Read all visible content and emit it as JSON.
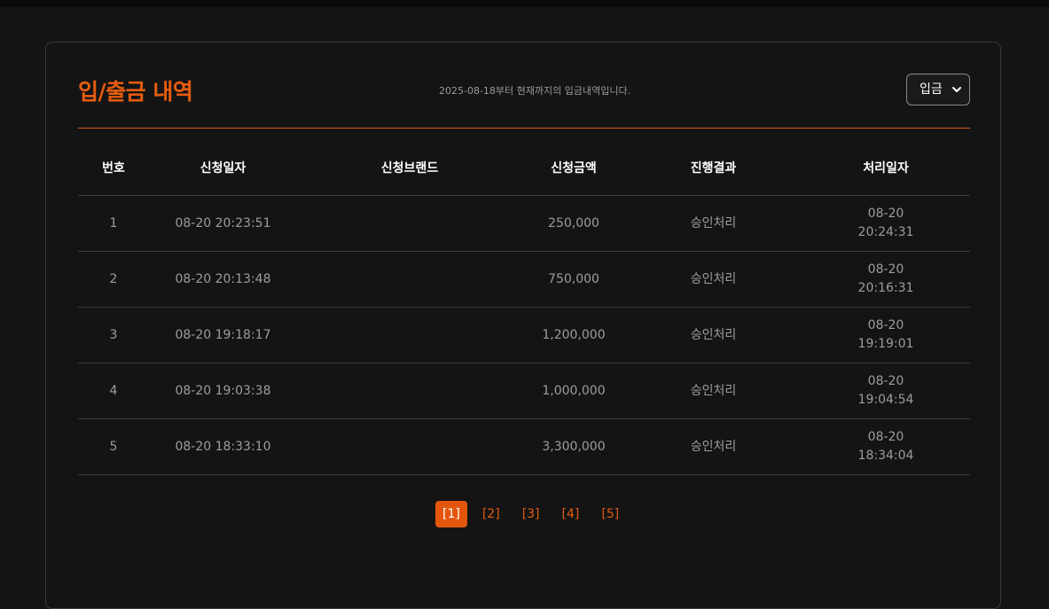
{
  "header": {
    "title": "입/출금 내역",
    "subtitle": "2025-08-18부터 현재까지의 입금내역입니다.",
    "type_select": {
      "selected": "입금"
    }
  },
  "table": {
    "columns": [
      "번호",
      "신청일자",
      "신청브랜드",
      "신청금액",
      "진행결과",
      "처리일자"
    ],
    "rows": [
      {
        "no": "1",
        "request_date": "08-20 20:23:51",
        "brand": "",
        "amount": "250,000",
        "result": "승인처리",
        "processed_date": "08-20",
        "processed_time": "20:24:31"
      },
      {
        "no": "2",
        "request_date": "08-20 20:13:48",
        "brand": "",
        "amount": "750,000",
        "result": "승인처리",
        "processed_date": "08-20",
        "processed_time": "20:16:31"
      },
      {
        "no": "3",
        "request_date": "08-20 19:18:17",
        "brand": "",
        "amount": "1,200,000",
        "result": "승인처리",
        "processed_date": "08-20",
        "processed_time": "19:19:01"
      },
      {
        "no": "4",
        "request_date": "08-20 19:03:38",
        "brand": "",
        "amount": "1,000,000",
        "result": "승인처리",
        "processed_date": "08-20",
        "processed_time": "19:04:54"
      },
      {
        "no": "5",
        "request_date": "08-20 18:33:10",
        "brand": "",
        "amount": "3,300,000",
        "result": "승인처리",
        "processed_date": "08-20",
        "processed_time": "18:34:04"
      }
    ]
  },
  "pagination": {
    "pages": [
      "[1]",
      "[2]",
      "[3]",
      "[4]",
      "[5]"
    ],
    "current": "[1]"
  },
  "colors": {
    "accent": "#e65c0e",
    "background": "#151515",
    "text_muted": "#9d9d9d"
  }
}
